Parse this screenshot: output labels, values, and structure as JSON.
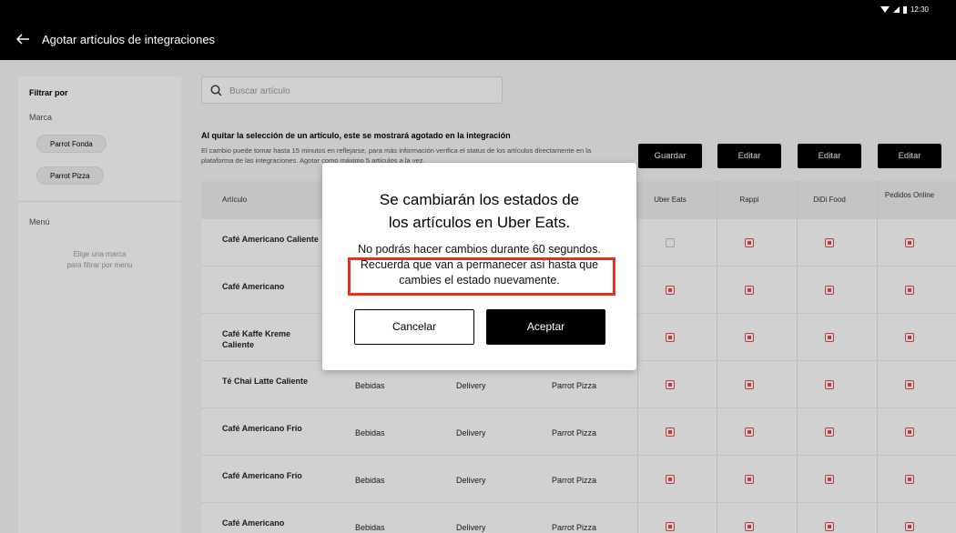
{
  "status": {
    "time": "12:30"
  },
  "header": {
    "title": "Agotar artículos de integraciones"
  },
  "sidebar": {
    "filter_label": "Filtrar por",
    "brand_label": "Marca",
    "brands": [
      "Parrot Fonda",
      "Parrot Pizza"
    ],
    "menu_label": "Menú",
    "menu_empty": [
      "Elige una marca",
      "para filtrar por menu"
    ]
  },
  "search": {
    "placeholder": "Buscar artículo"
  },
  "info": {
    "title": "Al quitar la selección de un artículo, este se mostrará agotado en la integración",
    "text": "El cambio puede tomar hasta 15 minutos en reflejarse, para más información verifica el status de los artículos directamente en la plataforma de las integraciones. Agotar como máximo 5 artículos a la vez."
  },
  "actions": {
    "save": "Guardar",
    "edit_rappi": "Editar",
    "edit_didi": "Editar",
    "edit_pedidos": "Editar"
  },
  "table": {
    "columns": {
      "article": "Artículo",
      "uber": "Uber Eats",
      "rappi": "Rappi",
      "didi": "DiDi Food",
      "pedidos": "Pedidos Online"
    },
    "rows": [
      {
        "name": "Café Americano Caliente",
        "category": "",
        "channel": "",
        "brand": "",
        "uber": false,
        "rappi": true,
        "didi": true,
        "pedidos": true
      },
      {
        "name": "Café Americano",
        "category": "",
        "channel": "",
        "brand": "",
        "uber": true,
        "rappi": true,
        "didi": true,
        "pedidos": true
      },
      {
        "name": "Café Kaffe Kreme Caliente",
        "category": "",
        "channel": "",
        "brand": "",
        "uber": true,
        "rappi": true,
        "didi": true,
        "pedidos": true
      },
      {
        "name": "Té Chai Latte Caliente",
        "category": "Bebidas",
        "channel": "Delivery",
        "brand": "Parrot Pizza",
        "uber": true,
        "rappi": true,
        "didi": true,
        "pedidos": true
      },
      {
        "name": "Café Americano Frío",
        "category": "Bebidas",
        "channel": "Delivery",
        "brand": "Parrot Pizza",
        "uber": true,
        "rappi": true,
        "didi": true,
        "pedidos": true
      },
      {
        "name": "Café Americano Frío",
        "category": "Bebidas",
        "channel": "Delivery",
        "brand": "Parrot Pizza",
        "uber": true,
        "rappi": true,
        "didi": true,
        "pedidos": true
      },
      {
        "name": "Café Americano",
        "category": "Bebidas",
        "channel": "Delivery",
        "brand": "Parrot Pizza",
        "uber": true,
        "rappi": true,
        "didi": true,
        "pedidos": true
      }
    ]
  },
  "modal": {
    "title_line1": "Se cambiarán los estados de",
    "title_line2": "los artículos en Uber Eats.",
    "body_line1": "No podrás hacer cambios durante 60 segundos.",
    "body_line2": "Recuerda que van a permanecer así hasta que",
    "body_line3": "cambies el estado nuevamente.",
    "cancel": "Cancelar",
    "accept": "Aceptar"
  },
  "colors": {
    "accent_red": "#e24b4b",
    "highlight_red": "#e5301f",
    "dark": "#000000"
  }
}
